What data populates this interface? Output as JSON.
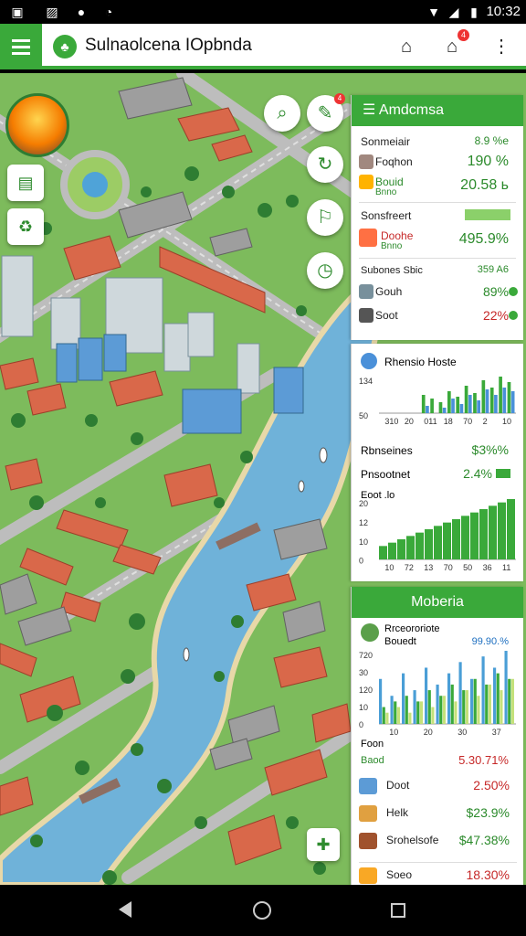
{
  "status_bar": {
    "time": "10:32"
  },
  "app_bar": {
    "title": "Sulnaolcena IOpbnda",
    "notification_count": "4"
  },
  "map_controls": {
    "zoom_badge": "4"
  },
  "panel1": {
    "header": "Amdcmsa",
    "rows": [
      {
        "label": "Sonmeiair",
        "value": "8.9 %e"
      },
      {
        "label": "Foqhon",
        "value": "190 %"
      },
      {
        "label": "Bouid",
        "label2": "Bnno",
        "value": "20.58 ь"
      },
      {
        "label": "Sonsfreert",
        "value": ""
      },
      {
        "label": "Doohe",
        "label2": "Bnno",
        "value": "495.9%"
      },
      {
        "label": "Subones Sbic",
        "value": "359 A6"
      },
      {
        "label": "Gouh",
        "value": "89%"
      },
      {
        "label": "Soot",
        "value": "22%"
      }
    ]
  },
  "panel2": {
    "title": "Rhensio Hoste",
    "row_label": "Rbnseines",
    "row_value": "$3%%",
    "row2_label": "Pnsootnet",
    "row2_value": "2.4%",
    "chart_label": "Eoot .lo"
  },
  "panel3": {
    "header": "Moberia",
    "sub_label": "Rrceororiote",
    "sub_label2": "Bouedt",
    "sub_value": "99.90.%",
    "below_label": "Foon",
    "below_label2": "Baod",
    "below_value": "5.30.71%",
    "rows": [
      {
        "label": "Doot",
        "value": "2.50%"
      },
      {
        "label": "Helk",
        "value": "$23.9%"
      },
      {
        "label": "Srohelsofe",
        "value": "$47.38%"
      },
      {
        "label": "Soeo",
        "value": "18.30%"
      }
    ]
  },
  "chart_data": [
    {
      "type": "bar",
      "title": "Rhensio Hoste",
      "categories": [
        "310",
        "20",
        "011",
        "18",
        "70",
        "2",
        "10"
      ],
      "series": [
        {
          "values": [
            0,
            0,
            0,
            0,
            0,
            1,
            0.8,
            0.6,
            1.2,
            0.9,
            1.5,
            1.1,
            1.8,
            1.4,
            2.0,
            1.7
          ]
        },
        {
          "values": [
            0,
            0,
            0,
            0,
            0,
            0.4,
            0,
            0.3,
            0.8,
            0.5,
            1.0,
            0.7,
            1.3,
            1.0,
            1.4,
            1.2
          ]
        }
      ],
      "ylabels": [
        "134",
        "50"
      ]
    },
    {
      "type": "bar",
      "categories": [
        "10",
        "72",
        "13",
        "70",
        "50",
        "36",
        "11"
      ],
      "values": [
        4,
        5,
        6,
        7,
        8,
        9,
        10,
        11,
        12,
        13,
        14,
        15,
        16,
        17,
        18
      ],
      "ylabels": [
        "20",
        "12",
        "10",
        "0"
      ]
    },
    {
      "type": "bar",
      "categories": [
        "10",
        "20",
        "30",
        "37"
      ],
      "series": [
        {
          "values": [
            8,
            5,
            9,
            6,
            10,
            7,
            9,
            11,
            8,
            12,
            10,
            13
          ]
        },
        {
          "values": [
            3,
            4,
            5,
            4,
            6,
            5,
            7,
            6,
            8,
            7,
            9,
            8
          ]
        },
        {
          "values": [
            2,
            3,
            2,
            4,
            3,
            5,
            4,
            6,
            5,
            7,
            6,
            8
          ]
        }
      ],
      "ylabels": [
        "720",
        "30",
        "120",
        "10",
        "0"
      ]
    }
  ]
}
